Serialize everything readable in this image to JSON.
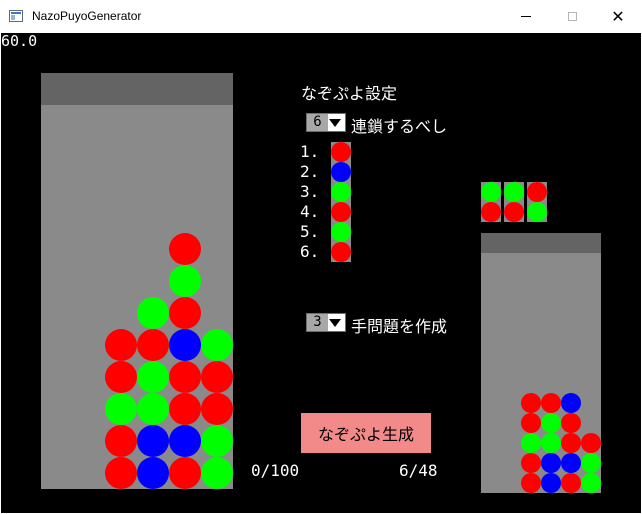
{
  "window": {
    "title": "NazoPuyoGenerator",
    "min_icon": "minimize-icon",
    "max_icon": "maximize-icon",
    "close_icon": "close-icon",
    "close_glyph": "✕"
  },
  "fps": "60.0",
  "settings": {
    "heading": "なぞぷよ設定",
    "chain_value": "6",
    "chain_suffix": "連鎖するべし",
    "move_value": "3",
    "move_suffix": "手問題を作成",
    "generate_label": "なぞぷよ生成"
  },
  "chain_list": {
    "labels": [
      "1.",
      "2.",
      "3.",
      "4.",
      "5.",
      "6."
    ],
    "colors": [
      "red",
      "blue",
      "green",
      "red",
      "green",
      "red"
    ]
  },
  "counters": {
    "progress": "0/100",
    "count": "6/48"
  },
  "colors": {
    "red": "#ff0000",
    "green": "#00ff00",
    "blue": "#0000ff",
    "field": "#8a8a8a",
    "field_top": "#646464",
    "button": "#f28a8a"
  },
  "main_field": {
    "columns": 6,
    "cells": [
      {
        "col": 3,
        "row": 7,
        "color": "red"
      },
      {
        "col": 3,
        "row": 6,
        "color": "green"
      },
      {
        "col": 2,
        "row": 5,
        "color": "green"
      },
      {
        "col": 3,
        "row": 5,
        "color": "red"
      },
      {
        "col": 1,
        "row": 4,
        "color": "red"
      },
      {
        "col": 2,
        "row": 4,
        "color": "red"
      },
      {
        "col": 3,
        "row": 4,
        "color": "blue"
      },
      {
        "col": 4,
        "row": 4,
        "color": "green"
      },
      {
        "col": 1,
        "row": 3,
        "color": "red"
      },
      {
        "col": 2,
        "row": 3,
        "color": "green"
      },
      {
        "col": 3,
        "row": 3,
        "color": "red"
      },
      {
        "col": 4,
        "row": 3,
        "color": "red"
      },
      {
        "col": 1,
        "row": 2,
        "color": "green"
      },
      {
        "col": 2,
        "row": 2,
        "color": "green"
      },
      {
        "col": 3,
        "row": 2,
        "color": "red"
      },
      {
        "col": 4,
        "row": 2,
        "color": "red"
      },
      {
        "col": 1,
        "row": 1,
        "color": "red"
      },
      {
        "col": 2,
        "row": 1,
        "color": "blue"
      },
      {
        "col": 3,
        "row": 1,
        "color": "blue"
      },
      {
        "col": 4,
        "row": 1,
        "color": "green"
      },
      {
        "col": 1,
        "row": 0,
        "color": "red"
      },
      {
        "col": 2,
        "row": 0,
        "color": "blue"
      },
      {
        "col": 3,
        "row": 0,
        "color": "red"
      },
      {
        "col": 4,
        "row": 0,
        "color": "green"
      }
    ]
  },
  "next_pairs": [
    {
      "top": "green",
      "bottom": "red"
    },
    {
      "top": "green",
      "bottom": "red"
    },
    {
      "top": "red",
      "bottom": "green"
    }
  ],
  "preview_field": {
    "columns": 6,
    "cells": [
      {
        "col": 2,
        "row": 4,
        "color": "red"
      },
      {
        "col": 3,
        "row": 4,
        "color": "red"
      },
      {
        "col": 4,
        "row": 4,
        "color": "blue"
      },
      {
        "col": 2,
        "row": 3,
        "color": "red"
      },
      {
        "col": 3,
        "row": 3,
        "color": "green"
      },
      {
        "col": 4,
        "row": 3,
        "color": "red"
      },
      {
        "col": 2,
        "row": 2,
        "color": "green"
      },
      {
        "col": 3,
        "row": 2,
        "color": "green"
      },
      {
        "col": 4,
        "row": 2,
        "color": "red"
      },
      {
        "col": 5,
        "row": 2,
        "color": "red"
      },
      {
        "col": 2,
        "row": 1,
        "color": "red"
      },
      {
        "col": 3,
        "row": 1,
        "color": "blue"
      },
      {
        "col": 4,
        "row": 1,
        "color": "blue"
      },
      {
        "col": 5,
        "row": 1,
        "color": "green"
      },
      {
        "col": 2,
        "row": 0,
        "color": "red"
      },
      {
        "col": 3,
        "row": 0,
        "color": "blue"
      },
      {
        "col": 4,
        "row": 0,
        "color": "red"
      },
      {
        "col": 5,
        "row": 0,
        "color": "green"
      }
    ]
  }
}
